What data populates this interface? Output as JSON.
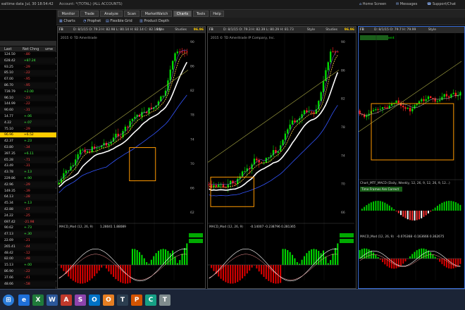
{
  "topbar": {
    "realtime": "ealtime data",
    "date": "Jul, 30 18:54:42",
    "account": "Account: *(TOTAL) (ALL ACCOUNTS)",
    "home": "Home Screen",
    "messages": "Messages",
    "support": "Support/Chat"
  },
  "tabs": [
    "Monitor",
    "Trade",
    "Analyze",
    "Scan",
    "MarketWatch",
    "Charts",
    "Tools",
    "Help"
  ],
  "subtabs": [
    "Charts",
    "Prophet",
    "Flexible Grid",
    "Product Depth"
  ],
  "watchlist": {
    "headers": [
      "Last",
      "Net Chng",
      "ume"
    ],
    "rows": [
      {
        "last": "124.50",
        "chg": "-.80",
        "c": "#ff4444"
      },
      {
        "last": "628.42",
        "chg": "+87.24",
        "c": "#44ff44"
      },
      {
        "last": "93.25",
        "chg": "-.29",
        "c": "#ff4444"
      },
      {
        "last": "85.10",
        "chg": "-.22",
        "c": "#ff4444"
      },
      {
        "last": "67.00",
        "chg": "-.95",
        "c": "#ff4444"
      },
      {
        "last": "86.70",
        "chg": "-.95",
        "c": "#ff4444"
      },
      {
        "last": "739.79",
        "chg": "+2.00",
        "c": "#44ff44"
      },
      {
        "last": "96.10",
        "chg": "-.23",
        "c": "#ff4444"
      },
      {
        "last": "144.99",
        "chg": "-.22",
        "c": "#ff4444"
      },
      {
        "last": "90.60",
        "chg": "-.31",
        "c": "#ff4444"
      },
      {
        "last": "14.77",
        "chg": "+.06",
        "c": "#44ff44"
      },
      {
        "last": "4.22",
        "chg": "+.07",
        "c": "#44ff44"
      },
      {
        "last": "75.10",
        "chg": "-.29",
        "c": "#ff4444"
      },
      {
        "last": "96.96",
        "chg": "+6.52",
        "c": "#000000"
      },
      {
        "last": "42.37",
        "chg": "+.23",
        "c": "#44ff44"
      },
      {
        "last": "63.80",
        "chg": "-.34",
        "c": "#ff4444"
      },
      {
        "last": "397.35",
        "chg": "+6.11",
        "c": "#44ff44"
      },
      {
        "last": "65.28",
        "chg": "-.71",
        "c": "#ff4444"
      },
      {
        "last": "43.49",
        "chg": "-.31",
        "c": "#ff4444"
      },
      {
        "last": "43.78",
        "chg": "+.13",
        "c": "#44ff44"
      },
      {
        "last": "229.86",
        "chg": "+.90",
        "c": "#44ff44"
      },
      {
        "last": "42.96",
        "chg": "-.29",
        "c": "#ff4444"
      },
      {
        "last": "149.35",
        "chg": "-.39",
        "c": "#ff4444"
      },
      {
        "last": "64.13",
        "chg": "-.28",
        "c": "#ff4444"
      },
      {
        "last": "45.34",
        "chg": "+.13",
        "c": "#44ff44"
      },
      {
        "last": "42.88",
        "chg": "-.67",
        "c": "#ff4444"
      },
      {
        "last": "24.22",
        "chg": "-.25",
        "c": "#ff4444"
      },
      {
        "last": "697.42",
        "chg": "-21.98",
        "c": "#ff4444"
      },
      {
        "last": "90.62",
        "chg": "+.73",
        "c": "#44ff44"
      },
      {
        "last": "47.13",
        "chg": "+.30",
        "c": "#44ff44"
      },
      {
        "last": "22.69",
        "chg": "-.21",
        "c": "#ff4444"
      },
      {
        "last": "265.41",
        "chg": "-.44",
        "c": "#ff4444"
      },
      {
        "last": "48.42",
        "chg": "-.12",
        "c": "#ff4444"
      },
      {
        "last": "82.00",
        "chg": "-.48",
        "c": "#ff4444"
      },
      {
        "last": "15.13",
        "chg": "+.00",
        "c": "#44ff44"
      },
      {
        "last": "86.90",
        "chg": "-.22",
        "c": "#ff4444"
      },
      {
        "last": "37.66",
        "chg": "-.41",
        "c": "#ff4444"
      },
      {
        "last": "48.66",
        "chg": "-.58",
        "c": "#ff4444"
      }
    ]
  },
  "charts": [
    {
      "symbol": "FB",
      "info": "D: 8/1/15  O: 79.3  H: 82.98  L: 80.14  H: 82.14  C: 82.14  R:",
      "price": "96.96",
      "company": "2015 © TD Ameritrade",
      "studies": "Studies",
      "style": "Style",
      "macd": "MACD_Mod (12, 26, 9)",
      "macd_vals": "1.28041  1.88089",
      "price_labels": [
        "90",
        "86",
        "82",
        "78",
        "74",
        "70",
        "66",
        "62"
      ]
    },
    {
      "symbol": "FB",
      "info": "D: 8/1/15  O: 79.3  H: 82.39  L: 80.29  H: 81.73",
      "price": "96.96",
      "company": "2015 © TD Ameritrade IP Company, Inc.",
      "studies": "Studies",
      "style": "Style",
      "macd": "MACD_Mod (12, 26, 9)",
      "macd_vals": "-0.14007  -0.238796  0.281365",
      "price_labels": [
        "90",
        "86",
        "82",
        "78",
        "74",
        "70",
        "66"
      ]
    },
    {
      "symbol": "FB",
      "info": "D: 8/1/15  O: 79.7  H: 79.99",
      "price": "",
      "company": "Trading Environment",
      "studies": "Studies",
      "style": "Style",
      "macd": "MACD_Mod (12, 26, 9)",
      "macd_vals": "-0.076368  -0.163666  0.362675",
      "mtf": "Chart_MTF_MACD (Daily, Weekly, 12, 26, 9, 12, 26, 9, 12...)",
      "mtf_note": "Time Frames Are Correct",
      "price_labels": []
    }
  ],
  "taskbar_icons": [
    "e",
    "X",
    "W",
    "A",
    "S",
    "O",
    "O",
    "T",
    "P",
    "C",
    "T"
  ]
}
